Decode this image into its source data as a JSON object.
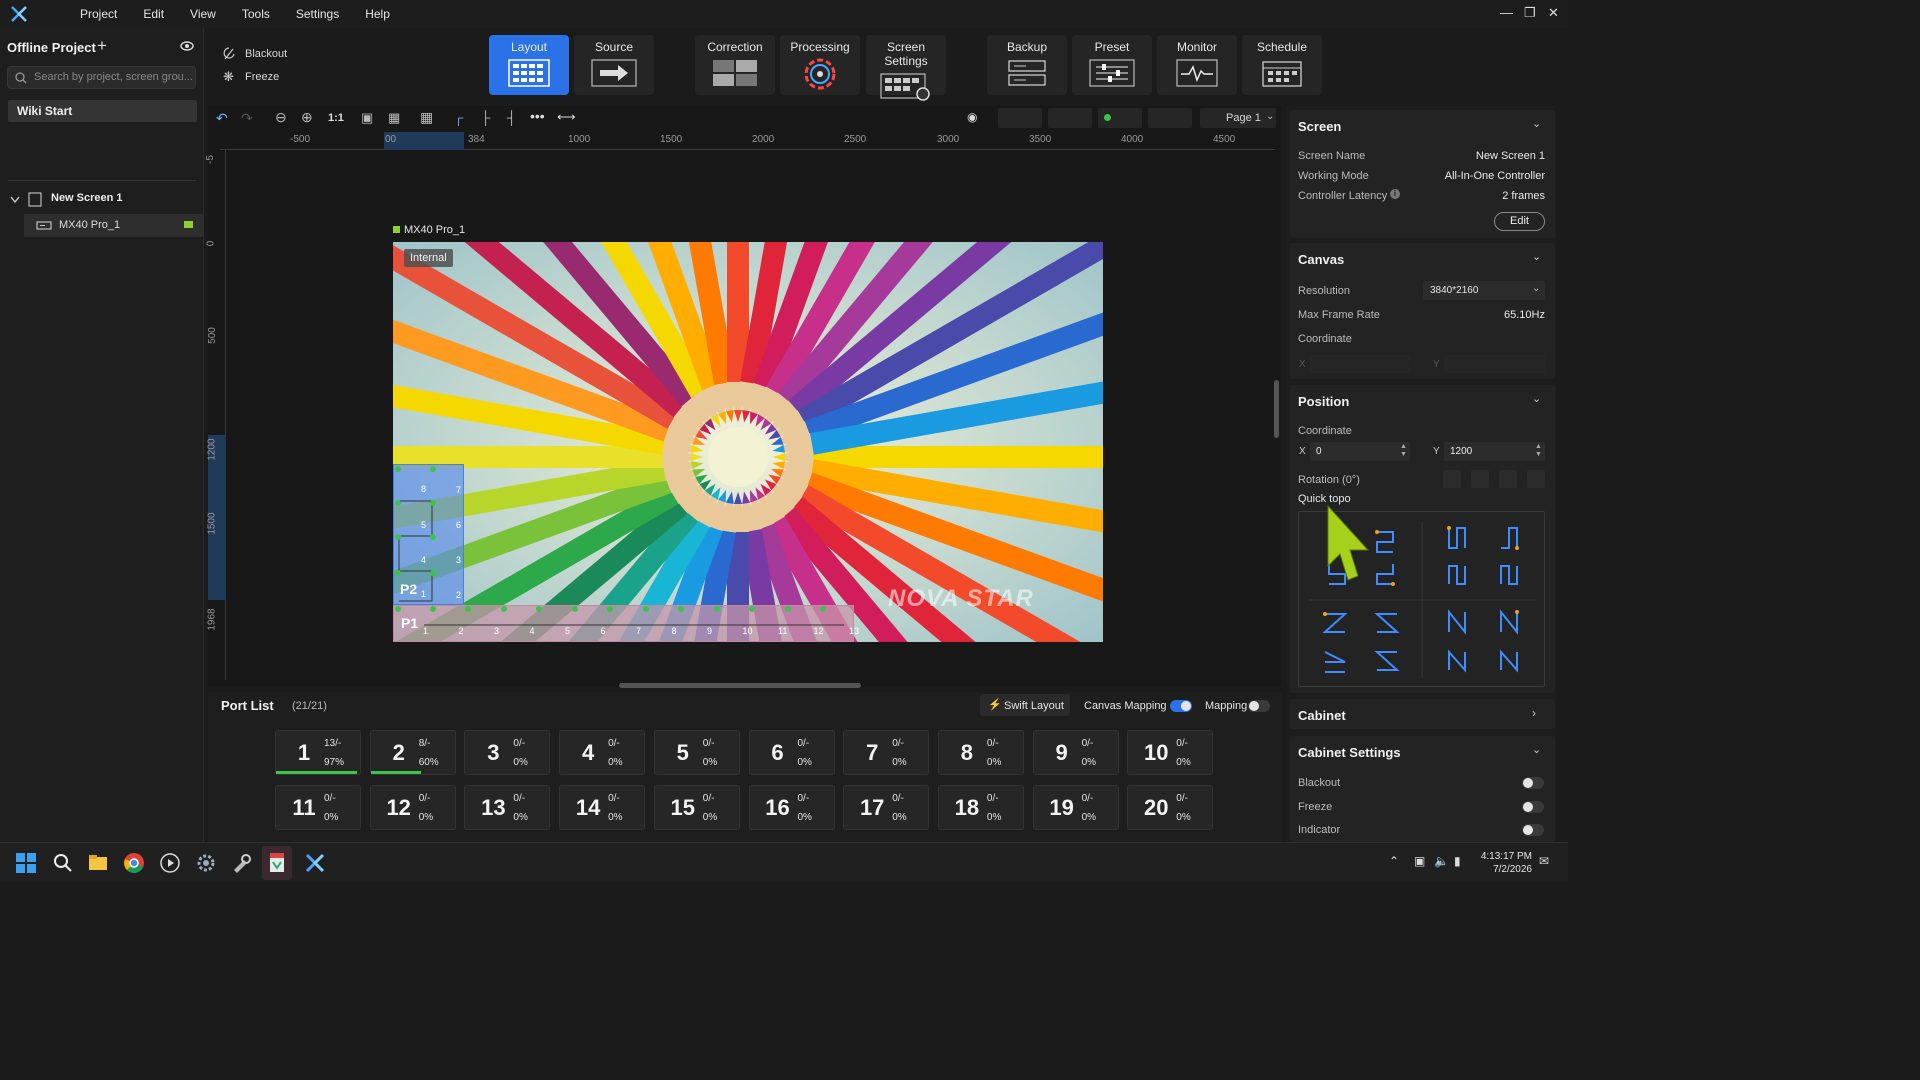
{
  "menubar": {
    "items": [
      "Project",
      "Edit",
      "View",
      "Tools",
      "Settings",
      "Help"
    ]
  },
  "left": {
    "project_title": "Offline Project",
    "search_placeholder": "Search by project, screen grou...",
    "wiki": "Wiki Start",
    "screen_name": "New Screen 1",
    "controller_name": "MX40 Pro_1"
  },
  "quick": {
    "blackout": "Blackout",
    "freeze": "Freeze"
  },
  "toolbar": {
    "buttons": [
      "Layout",
      "Source",
      "Correction",
      "Processing",
      "Screen Settings",
      "Backup",
      "Preset",
      "Monitor",
      "Schedule"
    ],
    "zoom_label": "1:1",
    "page_label": "Page 1"
  },
  "ruler": {
    "top": [
      "-500",
      "00",
      "384",
      "1500",
      "1000",
      "2000",
      "2500",
      "3000",
      "3500",
      "4000",
      "4500"
    ],
    "left": [
      "-5",
      "0",
      "500",
      "1200",
      "1500",
      "1968"
    ]
  },
  "canvas": {
    "controller_label": "MX40 Pro_1",
    "internal_badge": "Internal",
    "watermark": "NOVA STAR",
    "p1_label": "P1",
    "p2_label": "P2",
    "p1_numbers": [
      "1",
      "2",
      "3",
      "4",
      "5",
      "6",
      "7",
      "8",
      "9",
      "10",
      "11",
      "12",
      "13"
    ],
    "p2_numbers": [
      "8",
      "7",
      "5",
      "6",
      "4",
      "3",
      "1",
      "2"
    ]
  },
  "portlist": {
    "title": "Port List",
    "count": "(21/21)",
    "swift_layout": "Swift Layout",
    "canvas_mapping": "Canvas Mapping",
    "canvas_mapping_on": true,
    "mapping": "Mapping",
    "mapping_on": false,
    "ports": [
      {
        "num": "1",
        "cnt": "13/-",
        "pct": "97%",
        "load": 0.97
      },
      {
        "num": "2",
        "cnt": "8/-",
        "pct": "60%",
        "load": 0.6
      },
      {
        "num": "3",
        "cnt": "0/-",
        "pct": "0%",
        "load": 0
      },
      {
        "num": "4",
        "cnt": "0/-",
        "pct": "0%",
        "load": 0
      },
      {
        "num": "5",
        "cnt": "0/-",
        "pct": "0%",
        "load": 0
      },
      {
        "num": "6",
        "cnt": "0/-",
        "pct": "0%",
        "load": 0
      },
      {
        "num": "7",
        "cnt": "0/-",
        "pct": "0%",
        "load": 0
      },
      {
        "num": "8",
        "cnt": "0/-",
        "pct": "0%",
        "load": 0
      },
      {
        "num": "9",
        "cnt": "0/-",
        "pct": "0%",
        "load": 0
      },
      {
        "num": "10",
        "cnt": "0/-",
        "pct": "0%",
        "load": 0
      },
      {
        "num": "11",
        "cnt": "0/-",
        "pct": "0%",
        "load": 0
      },
      {
        "num": "12",
        "cnt": "0/-",
        "pct": "0%",
        "load": 0
      },
      {
        "num": "13",
        "cnt": "0/-",
        "pct": "0%",
        "load": 0
      },
      {
        "num": "14",
        "cnt": "0/-",
        "pct": "0%",
        "load": 0
      },
      {
        "num": "15",
        "cnt": "0/-",
        "pct": "0%",
        "load": 0
      },
      {
        "num": "16",
        "cnt": "0/-",
        "pct": "0%",
        "load": 0
      },
      {
        "num": "17",
        "cnt": "0/-",
        "pct": "0%",
        "load": 0
      },
      {
        "num": "18",
        "cnt": "0/-",
        "pct": "0%",
        "load": 0
      },
      {
        "num": "19",
        "cnt": "0/-",
        "pct": "0%",
        "load": 0
      },
      {
        "num": "20",
        "cnt": "0/-",
        "pct": "0%",
        "load": 0
      }
    ]
  },
  "right": {
    "screen": {
      "title": "Screen",
      "name_label": "Screen Name",
      "name_value": "New Screen 1",
      "mode_label": "Working Mode",
      "mode_value": "All-In-One Controller",
      "latency_label": "Controller Latency",
      "latency_value": "2 frames",
      "edit": "Edit"
    },
    "canvas": {
      "title": "Canvas",
      "resolution_label": "Resolution",
      "resolution_value": "3840*2160",
      "framerate_label": "Max Frame Rate",
      "framerate_value": "65.10Hz",
      "coordinate_label": "Coordinate",
      "x_label": "X",
      "y_label": "Y"
    },
    "position": {
      "title": "Position",
      "coordinate_label": "Coordinate",
      "x_label": "X",
      "x_value": "0",
      "y_label": "Y",
      "y_value": "1200",
      "rotation_label": "Rotation (0°)",
      "quicktopo_label": "Quick topo"
    },
    "cabinet": {
      "title": "Cabinet"
    },
    "cabinet_settings": {
      "title": "Cabinet Settings",
      "blackout": "Blackout",
      "freeze": "Freeze",
      "indicator": "Indicator"
    }
  },
  "taskbar": {
    "time": "4:13:17 PM",
    "date": "7/2/2026"
  },
  "colors": {
    "accent": "#2b72e8",
    "green": "#3dc34a",
    "topo_blue": "#3f8cff",
    "topo_orange": "#f0a020"
  }
}
